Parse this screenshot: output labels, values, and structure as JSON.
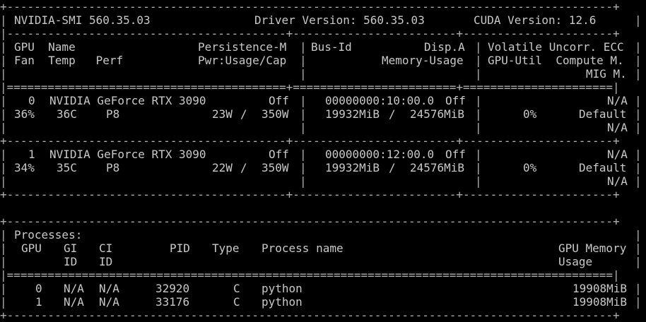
{
  "header": {
    "smi_label": "NVIDIA-SMI 560.35.03",
    "driver_label": "Driver Version: 560.35.03",
    "cuda_label": "CUDA Version: 12.6"
  },
  "gpu_table": {
    "headers": {
      "col1_line1": "GPU  Name",
      "col1_line1b": "Persistence-M",
      "col1_line2": "Fan  Temp   Perf",
      "col1_line2b": "Pwr:Usage/Cap",
      "col2_line1a": "Bus-Id",
      "col2_line1b": "Disp.A",
      "col2_line2": "Memory-Usage",
      "col3_line1": "Volatile Uncorr. ECC",
      "col3_line2": "GPU-Util  Compute M.",
      "col3_line3": "MIG M."
    },
    "gpus": [
      {
        "index": "0",
        "name": "NVIDIA GeForce RTX 3090",
        "persistence": "Off",
        "fan": "36%",
        "temp": "36C",
        "perf": "P8",
        "power_usage": "23W",
        "power_cap": "350W",
        "bus_id": "00000000:10:00.0",
        "disp_a": "Off",
        "memory_used": "19932MiB",
        "memory_total": "24576MiB",
        "ecc": "N/A",
        "gpu_util": "0%",
        "compute_mode": "Default",
        "mig_mode": "N/A"
      },
      {
        "index": "1",
        "name": "NVIDIA GeForce RTX 3090",
        "persistence": "Off",
        "fan": "34%",
        "temp": "35C",
        "perf": "P8",
        "power_usage": "22W",
        "power_cap": "350W",
        "bus_id": "00000000:12:00.0",
        "disp_a": "Off",
        "memory_used": "19932MiB",
        "memory_total": "24576MiB",
        "ecc": "N/A",
        "gpu_util": "0%",
        "compute_mode": "Default",
        "mig_mode": "N/A"
      }
    ]
  },
  "processes": {
    "title": "Processes:",
    "headers": {
      "gpu": "GPU",
      "gi": "GI",
      "gi_sub": "ID",
      "ci": "CI",
      "ci_sub": "ID",
      "pid": "PID",
      "type": "Type",
      "name": "Process name",
      "mem": "GPU Memory",
      "mem_sub": "Usage"
    },
    "rows": [
      {
        "gpu": "0",
        "gi": "N/A",
        "ci": "N/A",
        "pid": "32920",
        "type": "C",
        "name": "python",
        "mem": "19908MiB"
      },
      {
        "gpu": "1",
        "gi": "N/A",
        "ci": "N/A",
        "pid": "33176",
        "type": "C",
        "name": "python",
        "mem": "19908MiB"
      }
    ]
  }
}
